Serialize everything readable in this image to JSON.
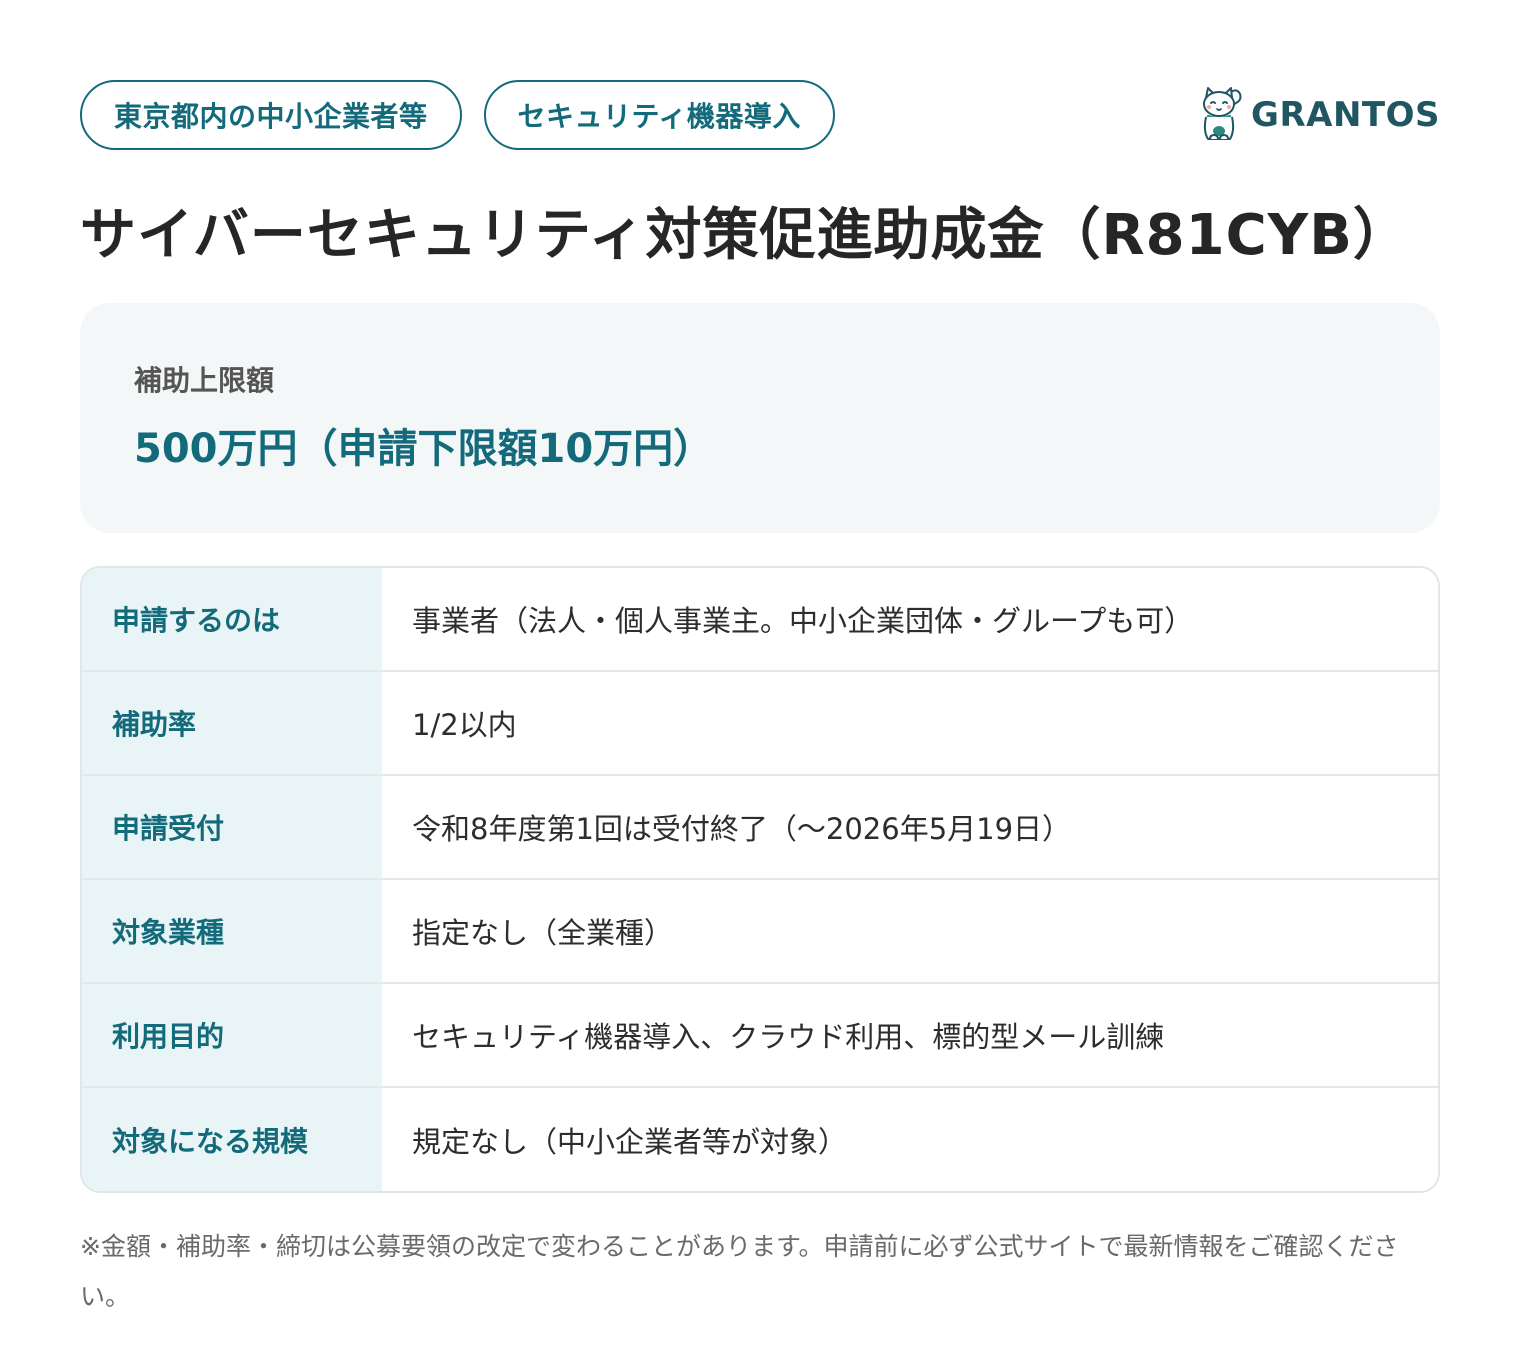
{
  "header": {
    "tags": [
      "東京都内の中小企業者等",
      "セキュリティ機器導入"
    ],
    "logo_text": "GRANTOS"
  },
  "title": "サイバーセキュリティ対策促進助成金（R81CYB）",
  "highlight": {
    "label": "補助上限額",
    "value": "500万円（申請下限額10万円）"
  },
  "details": [
    {
      "label": "申請するのは",
      "value": "事業者（法人・個人事業主。中小企業団体・グループも可）"
    },
    {
      "label": "補助率",
      "value": "1/2以内"
    },
    {
      "label": "申請受付",
      "value": "令和8年度第1回は受付終了（〜2026年5月19日）"
    },
    {
      "label": "対象業種",
      "value": "指定なし（全業種）"
    },
    {
      "label": "利用目的",
      "value": "セキュリティ機器導入、クラウド利用、標的型メール訓練"
    },
    {
      "label": "対象になる規模",
      "value": "規定なし（中小企業者等が対象）"
    }
  ],
  "note": "※金額・補助率・締切は公募要領の改定で変わることがあります。申請前に必ず公式サイトで最新情報をご確認ください。",
  "colors": {
    "accent": "#136a7a",
    "card_bg": "#f4f7f8",
    "label_bg": "#e9f4f6",
    "title": "#262626"
  }
}
